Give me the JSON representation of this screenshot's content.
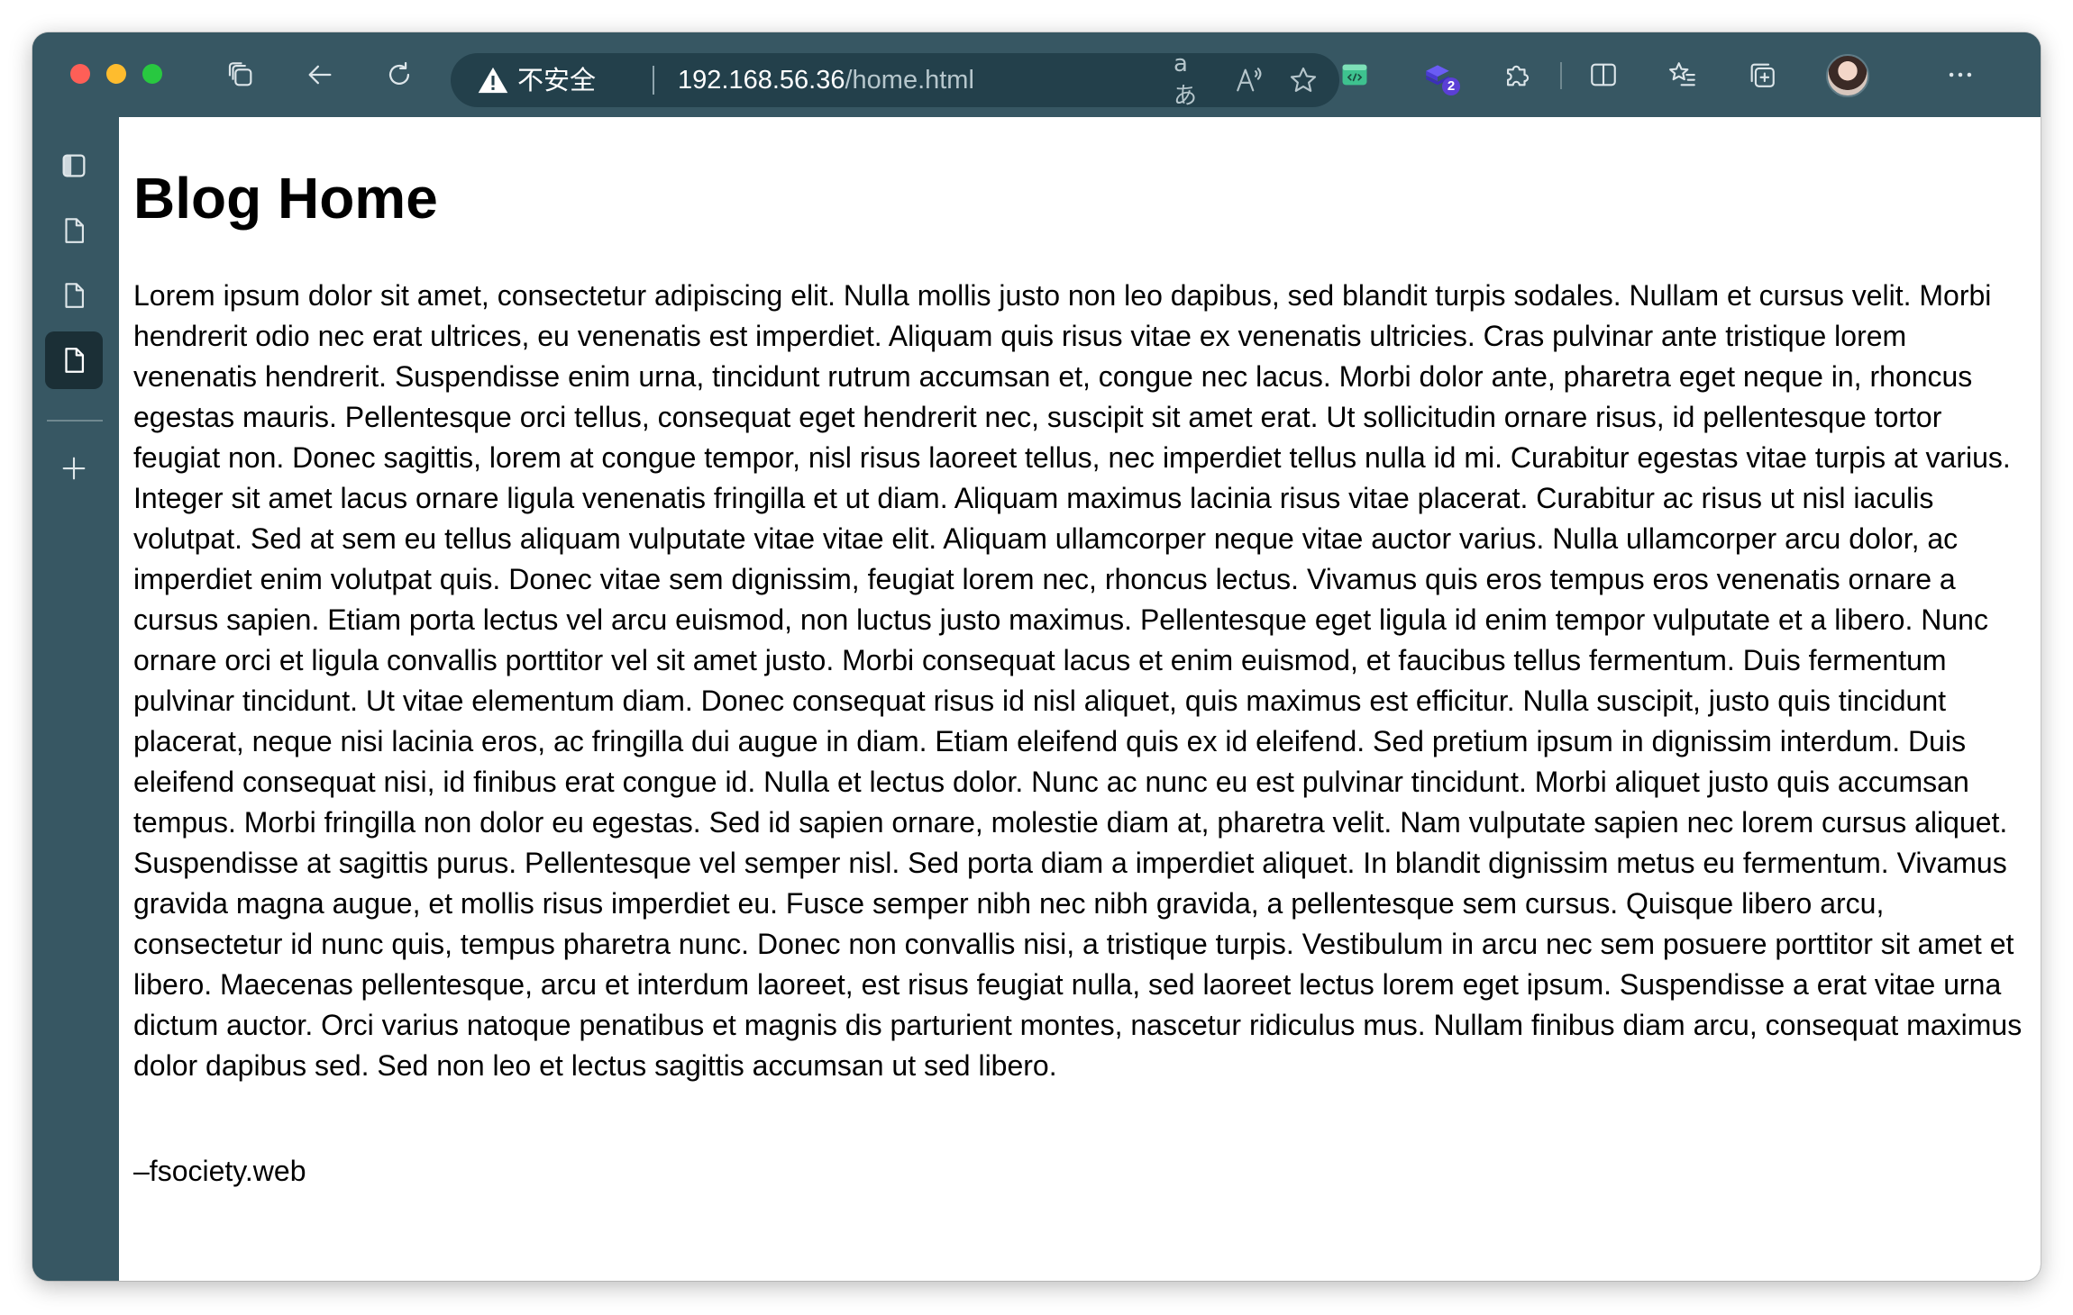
{
  "browser": {
    "address_bar": {
      "security_label": "不安全",
      "url_host": "192.168.56.36",
      "url_path": "/home.html",
      "translate_glyph": "aあ",
      "read_aloud_glyph": "A"
    },
    "extensions_badge": "2",
    "icons": {
      "tabs": "tab-actions-icon",
      "back": "back-arrow-icon",
      "refresh": "refresh-icon",
      "warning": "warning-icon",
      "translate": "translate-icon",
      "read_aloud": "read-aloud-icon",
      "favorite": "star-icon",
      "devtools": "code-window-icon",
      "extension_stack": "stack-extension-icon",
      "extensions": "puzzle-icon",
      "split_screen": "split-screen-icon",
      "favorites": "favorites-list-icon",
      "collections": "collections-icon",
      "more": "more-icon"
    },
    "colors": {
      "frame": "#375763",
      "address_bar": "#23404b",
      "active_tab": "#1b2f36",
      "badge": "#5b3fd6"
    }
  },
  "sidebar": {
    "items": [
      {
        "name": "sidebar-toggle-icon",
        "active": false
      },
      {
        "name": "tab-page-icon",
        "active": false
      },
      {
        "name": "tab-page-icon",
        "active": false
      },
      {
        "name": "tab-page-icon",
        "active": true
      },
      {
        "name": "new-tab-plus-icon",
        "active": false
      }
    ]
  },
  "page": {
    "title": "Blog Home",
    "body": "Lorem ipsum dolor sit amet, consectetur adipiscing elit. Nulla mollis justo non leo dapibus, sed blandit turpis sodales. Nullam et cursus velit. Morbi hendrerit odio nec erat ultrices, eu venenatis est imperdiet. Aliquam quis risus vitae ex venenatis ultricies. Cras pulvinar ante tristique lorem venenatis hendrerit. Suspendisse enim urna, tincidunt rutrum accumsan et, congue nec lacus. Morbi dolor ante, pharetra eget neque in, rhoncus egestas mauris. Pellentesque orci tellus, consequat eget hendrerit nec, suscipit sit amet erat. Ut sollicitudin ornare risus, id pellentesque tortor feugiat non. Donec sagittis, lorem at congue tempor, nisl risus laoreet tellus, nec imperdiet tellus nulla id mi. Curabitur egestas vitae turpis at varius. Integer sit amet lacus ornare ligula venenatis fringilla et ut diam. Aliquam maximus lacinia risus vitae placerat. Curabitur ac risus ut nisl iaculis volutpat. Sed at sem eu tellus aliquam vulputate vitae vitae elit. Aliquam ullamcorper neque vitae auctor varius. Nulla ullamcorper arcu dolor, ac imperdiet enim volutpat quis. Donec vitae sem dignissim, feugiat lorem nec, rhoncus lectus. Vivamus quis eros tempus eros venenatis ornare a cursus sapien. Etiam porta lectus vel arcu euismod, non luctus justo maximus. Pellentesque eget ligula id enim tempor vulputate et a libero. Nunc ornare orci et ligula convallis porttitor vel sit amet justo. Morbi consequat lacus et enim euismod, et faucibus tellus fermentum. Duis fermentum pulvinar tincidunt. Ut vitae elementum diam. Donec consequat risus id nisl aliquet, quis maximus est efficitur. Nulla suscipit, justo quis tincidunt placerat, neque nisi lacinia eros, ac fringilla dui augue in diam. Etiam eleifend quis ex id eleifend. Sed pretium ipsum in dignissim interdum. Duis eleifend consequat nisi, id finibus erat congue id. Nulla et lectus dolor. Nunc ac nunc eu est pulvinar tincidunt. Morbi aliquet justo quis accumsan tempus. Morbi fringilla non dolor eu egestas. Sed id sapien ornare, molestie diam at, pharetra velit. Nam vulputate sapien nec lorem cursus aliquet. Suspendisse at sagittis purus. Pellentesque vel semper nisl. Sed porta diam a imperdiet aliquet. In blandit dignissim metus eu fermentum. Vivamus gravida magna augue, et mollis risus imperdiet eu. Fusce semper nibh nec nibh gravida, a pellentesque sem cursus. Quisque libero arcu, consectetur id nunc quis, tempus pharetra nunc. Donec non convallis nisi, a tristique turpis. Vestibulum in arcu nec sem posuere porttitor sit amet et libero. Maecenas pellentesque, arcu et interdum laoreet, est risus feugiat nulla, sed laoreet lectus lorem eget ipsum. Suspendisse a erat vitae urna dictum auctor. Orci varius natoque penatibus et magnis dis parturient montes, nascetur ridiculus mus. Nullam finibus diam arcu, consequat maximus dolor dapibus sed. Sed non leo et lectus sagittis accumsan ut sed libero.",
    "signature": "–fsociety.web"
  }
}
